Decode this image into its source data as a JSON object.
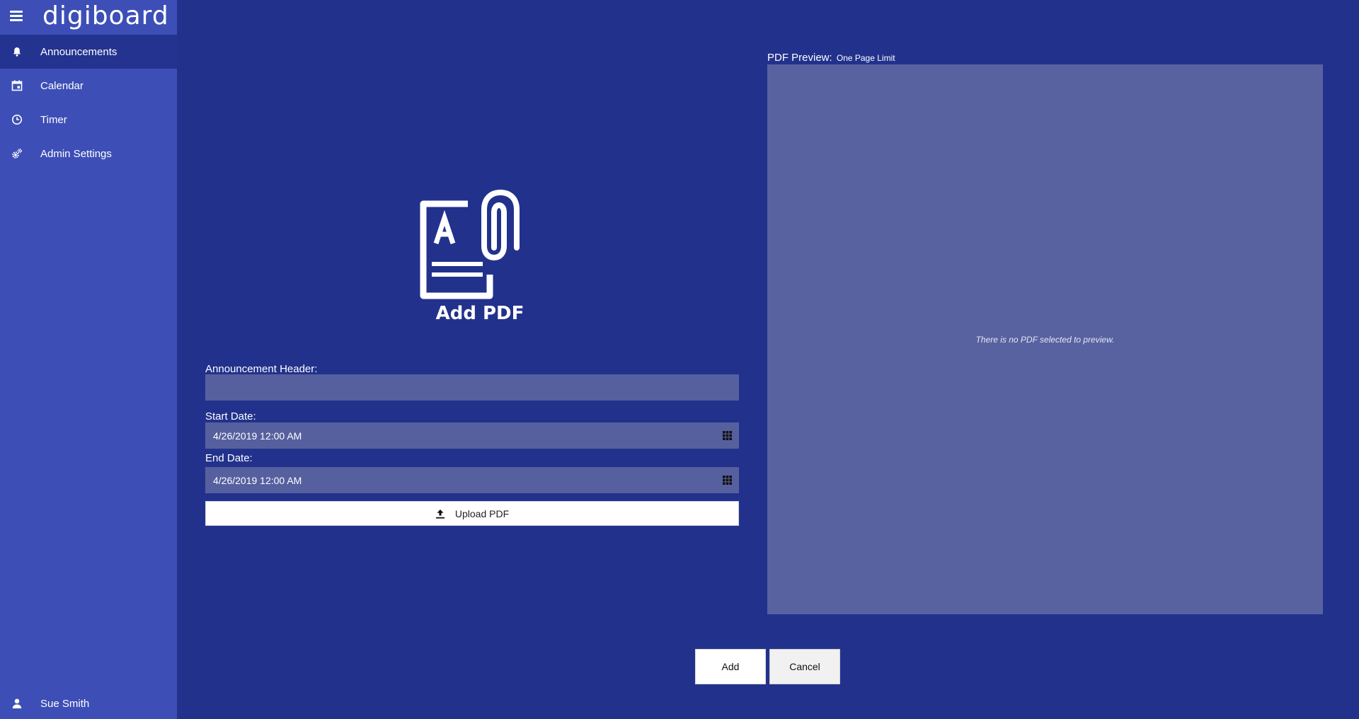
{
  "app": {
    "logo_text": "digiboard"
  },
  "sidebar": {
    "items": [
      {
        "label": "Announcements",
        "icon": "bell-icon",
        "active": true
      },
      {
        "label": "Calendar",
        "icon": "calendar-icon",
        "active": false
      },
      {
        "label": "Timer",
        "icon": "clock-icon",
        "active": false
      },
      {
        "label": "Admin Settings",
        "icon": "gears-icon",
        "active": false
      }
    ],
    "user": {
      "label": "Sue Smith",
      "icon": "user-icon"
    }
  },
  "form": {
    "title": "Add PDF",
    "header_label": "Announcement Header:",
    "header_value": "",
    "start_label": "Start Date:",
    "start_value": "4/26/2019 12:00 AM",
    "end_label": "End Date:",
    "end_value": "4/26/2019 12:00 AM",
    "upload_label": "Upload PDF"
  },
  "preview": {
    "label": "PDF Preview:",
    "sublabel": "One Page Limit",
    "empty_text": "There is no PDF selected to preview."
  },
  "actions": {
    "add_label": "Add",
    "cancel_label": "Cancel"
  },
  "colors": {
    "background": "#22328c",
    "sidebar": "#3d4fb6",
    "sidebar_active": "#23338f",
    "field": "#56609f",
    "preview": "#5862a1"
  }
}
